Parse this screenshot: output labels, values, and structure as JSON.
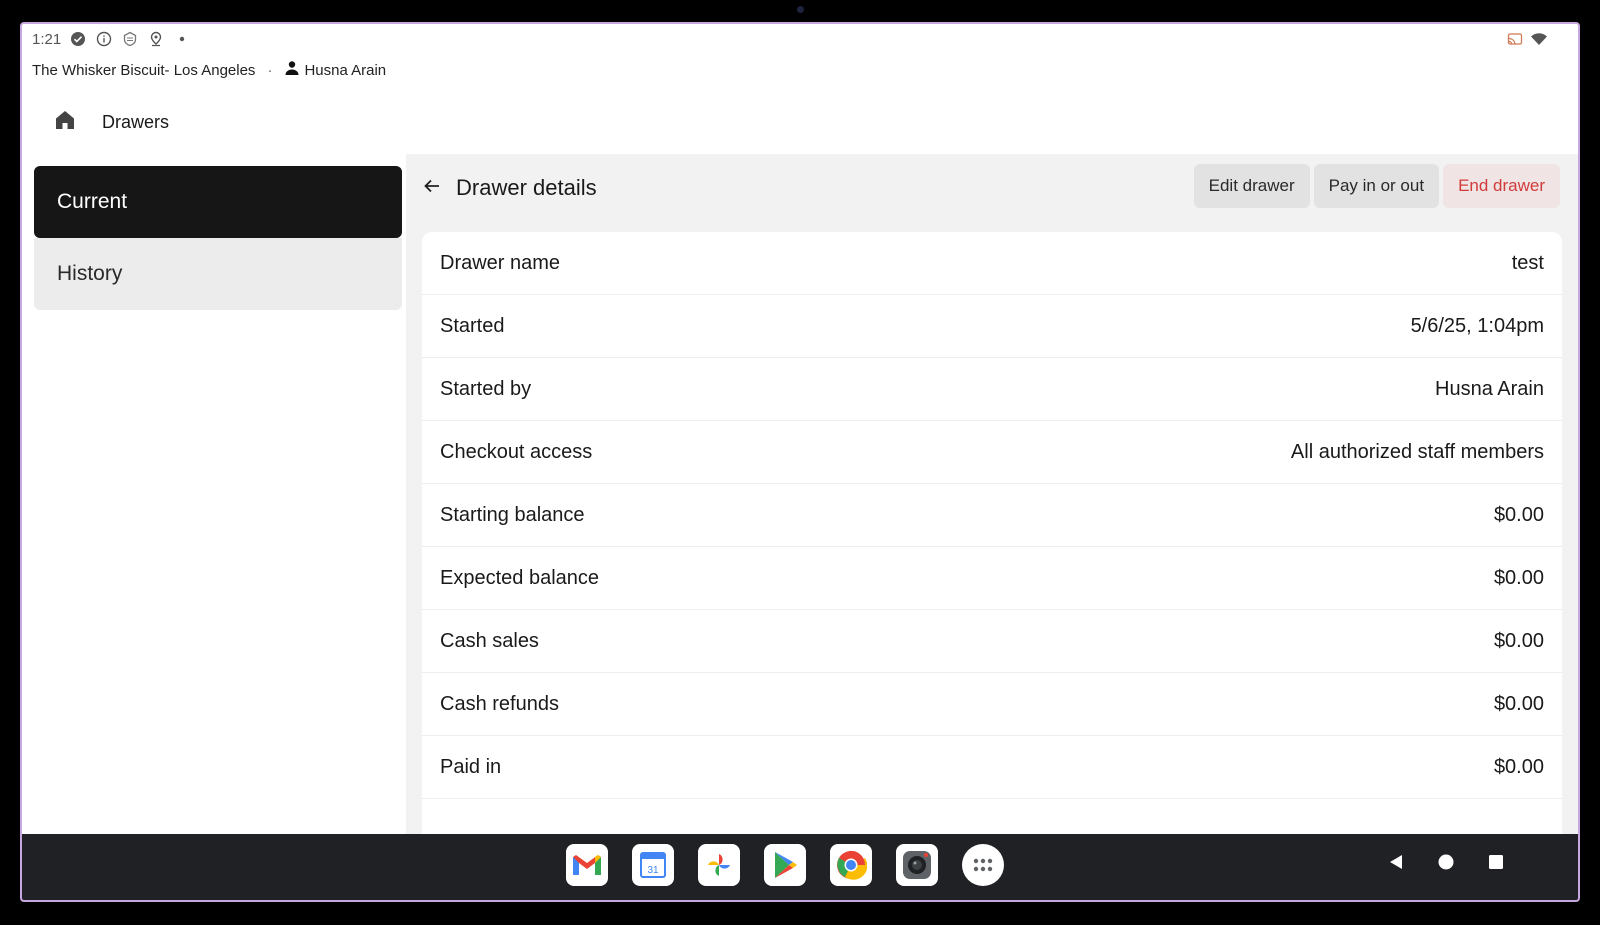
{
  "status_bar": {
    "time": "1:21",
    "icons": [
      "check-circle-icon",
      "info-icon",
      "shield-icon",
      "location-pin-icon",
      "dot-icon"
    ],
    "right_icons": [
      "cast-icon",
      "wifi-icon"
    ]
  },
  "location": {
    "business": "The Whisker Biscuit- Los Angeles",
    "separator": "·",
    "user": "Husna Arain"
  },
  "nav": {
    "title": "Drawers"
  },
  "sidebar": {
    "items": [
      {
        "label": "Current",
        "active": true
      },
      {
        "label": "History",
        "active": false
      }
    ]
  },
  "panel": {
    "title": "Drawer details",
    "actions": {
      "edit": "Edit drawer",
      "pay": "Pay in or out",
      "end": "End drawer"
    },
    "rows": [
      {
        "label": "Drawer name",
        "value": "test"
      },
      {
        "label": "Started",
        "value": "5/6/25, 1:04pm"
      },
      {
        "label": "Started by",
        "value": "Husna Arain"
      },
      {
        "label": "Checkout access",
        "value": "All authorized staff members"
      },
      {
        "label": "Starting balance",
        "value": "$0.00"
      },
      {
        "label": "Expected balance",
        "value": "$0.00"
      },
      {
        "label": "Cash sales",
        "value": "$0.00"
      },
      {
        "label": "Cash refunds",
        "value": "$0.00"
      },
      {
        "label": "Paid in",
        "value": "$0.00"
      }
    ]
  },
  "colors": {
    "accent_dark": "#161616",
    "danger": "#d03b3b",
    "panel_bg": "#f2f2f2",
    "taskbar_bg": "#202124"
  },
  "dock": [
    "gmail-icon",
    "calendar-icon",
    "photos-icon",
    "play-store-icon",
    "chrome-icon",
    "camera-icon",
    "app-drawer-icon"
  ],
  "calendar_day": "31"
}
